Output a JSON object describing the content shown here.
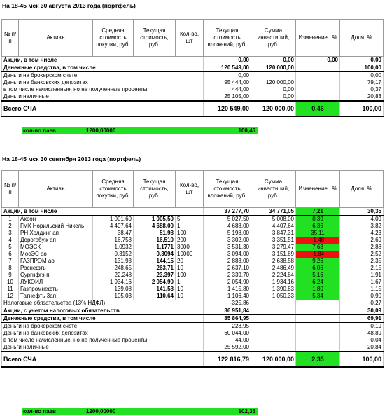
{
  "headers": [
    "№ п/п",
    "Активъ",
    "Средняя стоимость покупки, руб.",
    "Текущая стоимость, руб.",
    "Кол-во, шт",
    "Текущая стоимость вложений, руб.",
    "Сумма инвестиций, руб.",
    "Изменение , %",
    "Доля, %"
  ],
  "report1": {
    "title": "На 18-45 мск 30 августа 2013 года (портфель)",
    "sections": [
      {
        "label": "Акции, в том числе",
        "value": "0,00",
        "invest": "0,00",
        "change": "0,00",
        "share": "0,00"
      },
      {
        "label": "Денежные средства, в том числе",
        "value": "120 549,00",
        "invest": "120 000,00",
        "change": "",
        "share": "100,00"
      }
    ],
    "cash": [
      {
        "label": "Деньги на брокерском счете",
        "value": "0,00",
        "invest": "",
        "share": "0,00"
      },
      {
        "label": "Деньги на банковских депозитах",
        "value": "95 444,00",
        "invest": "120 000,00",
        "share": "79,17"
      },
      {
        "label": "в том числе начисленные, но не полученные проценты",
        "value": "444,00",
        "invest": "0,00",
        "share": "0,37"
      },
      {
        "label": "Деньги наличные",
        "value": "25 105,00",
        "invest": "0,00",
        "share": "20,83"
      }
    ],
    "total": {
      "label": "Всего СЧА",
      "value": "120 549,00",
      "invest": "120 000,00",
      "change": "0,46",
      "share": "100,00"
    },
    "units": {
      "label": "кол-во паев",
      "count": "1200,00000",
      "price": "100,46"
    }
  },
  "report2": {
    "title": "На 18-45 мск 30 сентября 2013 года (портфель)",
    "stocks_header": {
      "label": "Акции, в том числе",
      "value": "37 277,70",
      "invest": "34 771,05",
      "change": "7,21",
      "share": "30,35"
    },
    "stocks": [
      {
        "n": "1",
        "name": "Акрон",
        "avg": "1 001,60",
        "cur": "1 005,50",
        "qty": "5",
        "value": "5 027,50",
        "invest": "5 008,00",
        "change": "0,39",
        "share": "4,09",
        "neg": false
      },
      {
        "n": "2",
        "name": "ГМК Норильский Никель",
        "avg": "4 407,64",
        "cur": "4 688,00",
        "qty": "1",
        "value": "4 688,00",
        "invest": "4 407,64",
        "change": "6,36",
        "share": "3,82",
        "neg": false
      },
      {
        "n": "3",
        "name": "РН Холдинг ап",
        "avg": "38,47",
        "cur": "51,98",
        "qty": "100",
        "value": "5 198,00",
        "invest": "3 847,31",
        "change": "35,11",
        "share": "4,23",
        "neg": false
      },
      {
        "n": "4",
        "name": "Дорогобуж ап",
        "avg": "16,758",
        "cur": "16,510",
        "qty": "200",
        "value": "3 302,00",
        "invest": "3 351,51",
        "change": "-1,48",
        "share": "2,69",
        "neg": true
      },
      {
        "n": "5",
        "name": "МОЭСК",
        "avg": "1,0932",
        "cur": "1,1771",
        "qty": "3000",
        "value": "3 531,30",
        "invest": "3 279,47",
        "change": "7,68",
        "share": "2,88",
        "neg": false
      },
      {
        "n": "6",
        "name": "МосЭС ао",
        "avg": "0,3152",
        "cur": "0,3094",
        "qty": "10000",
        "value": "3 094,00",
        "invest": "3 151,89",
        "change": "-1,84",
        "share": "2,52",
        "neg": true
      },
      {
        "n": "7",
        "name": "ГАЗПРОМ ао",
        "avg": "131,93",
        "cur": "144,15",
        "qty": "20",
        "value": "2 883,00",
        "invest": "2 638,58",
        "change": "9,26",
        "share": "2,35",
        "neg": false
      },
      {
        "n": "8",
        "name": "Роснефть",
        "avg": "248,65",
        "cur": "263,71",
        "qty": "10",
        "value": "2 637,10",
        "invest": "2 486,49",
        "change": "6,06",
        "share": "2,15",
        "neg": false
      },
      {
        "n": "9",
        "name": "Сургнфгз-п",
        "avg": "22,248",
        "cur": "23,397",
        "qty": "100",
        "value": "2 339,70",
        "invest": "2 224,84",
        "change": "5,16",
        "share": "1,91",
        "neg": false
      },
      {
        "n": "10",
        "name": "ЛУКОЙЛ",
        "avg": "1 934,16",
        "cur": "2 054,90",
        "qty": "1",
        "value": "2 054,90",
        "invest": "1 934,16",
        "change": "6,24",
        "share": "1,67",
        "neg": false
      },
      {
        "n": "11",
        "name": "Газпромнефть",
        "avg": "139,08",
        "cur": "141,58",
        "qty": "10",
        "value": "1 415,80",
        "invest": "1 390,83",
        "change": "1,80",
        "share": "1,15",
        "neg": false
      },
      {
        "n": "12",
        "name": "Татнефть 3ап",
        "avg": "105,03",
        "cur": "110,64",
        "qty": "10",
        "value": "1 106,40",
        "invest": "1 050,33",
        "change": "5,34",
        "share": "0,90",
        "neg": false
      }
    ],
    "tax": {
      "label": "Налоговые обязательства (13% НДФЛ)",
      "value": "-325,86",
      "share": "-0,27"
    },
    "stocks_after_tax": {
      "label": "Акции, с учетом налоговых обязательств",
      "value": "36 951,84",
      "share": "30,09"
    },
    "cash_header": {
      "label": "Денежные средства, в том числе",
      "value": "85 864,95",
      "share": "69,91"
    },
    "cash": [
      {
        "label": "Деньги на брокерском счете",
        "value": "228,95",
        "share": "0,19"
      },
      {
        "label": "Деньги на банковских депозитах",
        "value": "60 044,00",
        "share": "48,89"
      },
      {
        "label": "в том числе начисленные, но не полученные проценты",
        "value": "44,00",
        "share": "0,04"
      },
      {
        "label": "Деньги наличные",
        "value": "25 592,00",
        "share": "20,84"
      }
    ],
    "total": {
      "label": "Всего СЧА",
      "value": "122 816,79",
      "invest": "120 000,00",
      "change": "2,35",
      "share": "100,00"
    },
    "units": {
      "label": "кол-во паев",
      "count": "1200,00000",
      "price": "102,35"
    }
  }
}
